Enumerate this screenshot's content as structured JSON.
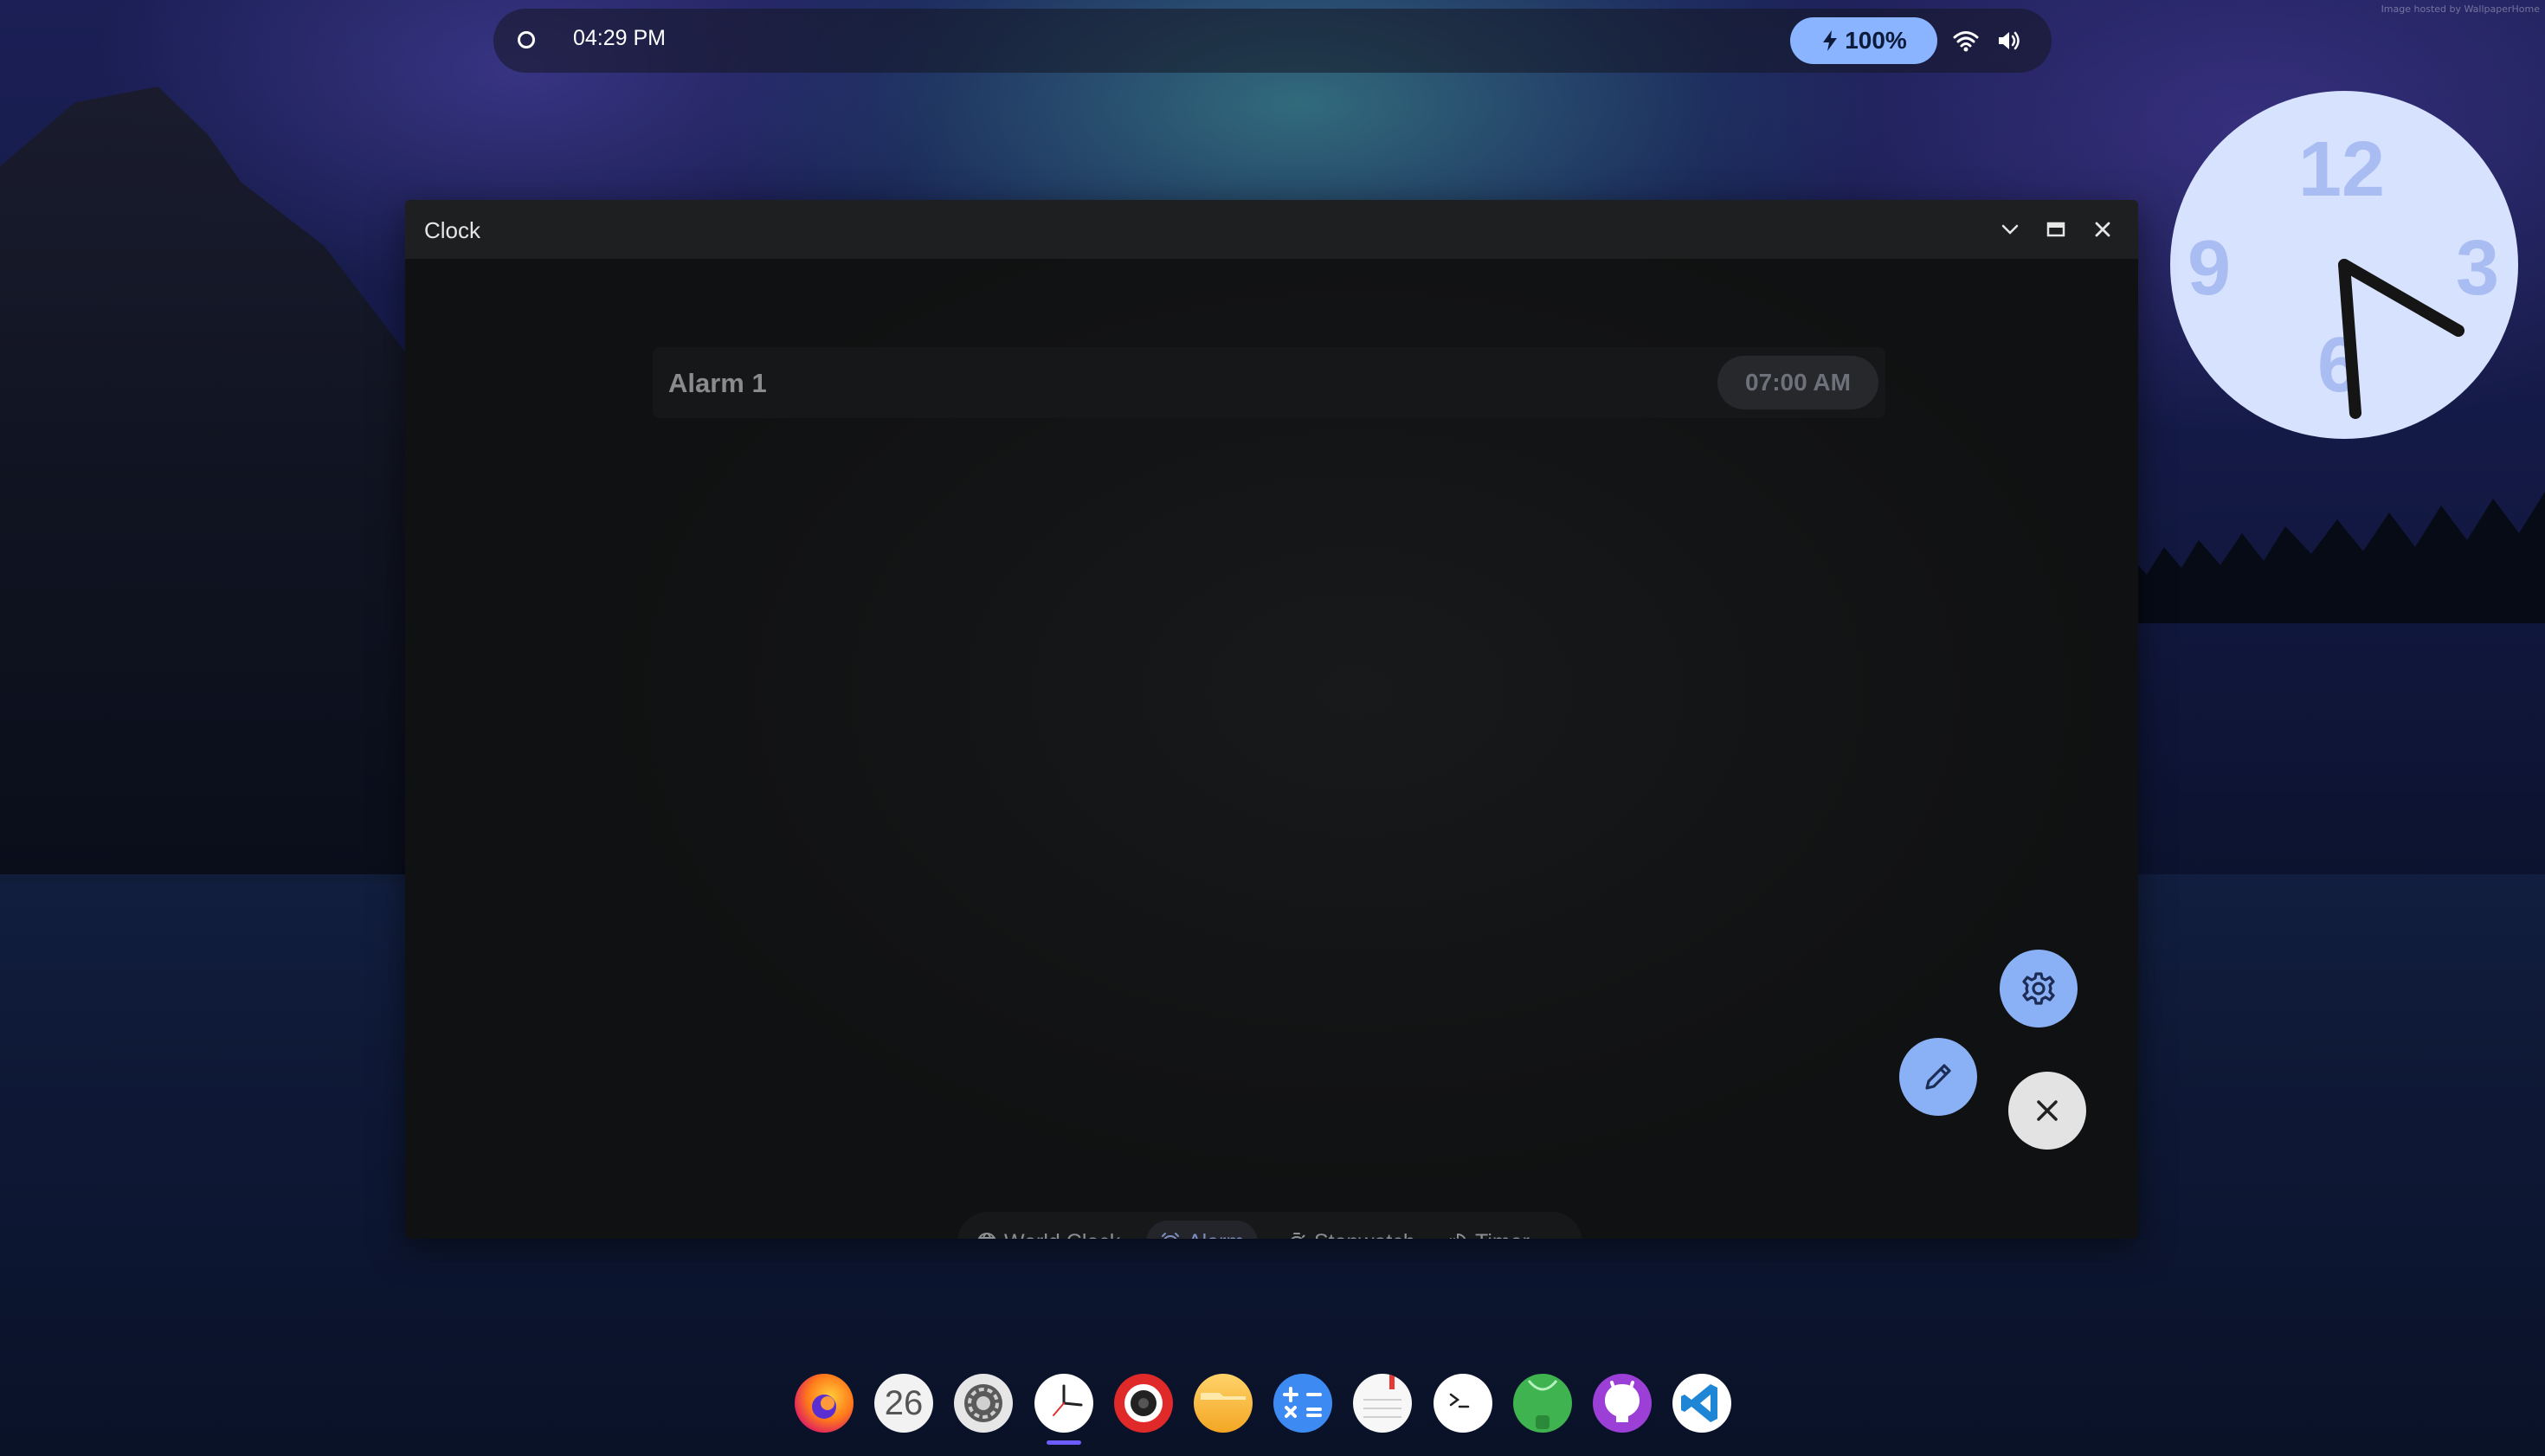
{
  "desktop": {
    "watermark": "Image hosted by WallpaperHome"
  },
  "topbar": {
    "time": "04:29 PM",
    "battery": "100%",
    "icons": [
      "circle-indicator",
      "bolt-icon",
      "wifi-icon",
      "volume-icon"
    ]
  },
  "analog_clock": {
    "numbers": [
      "12",
      "3",
      "6",
      "9"
    ],
    "hour_hand": "approximately 4:30",
    "colors": {
      "face": "#d7e2ff",
      "numbers": "#a9bdf2",
      "hands": "#151515"
    }
  },
  "window": {
    "title": "Clock",
    "controls": [
      "minimize",
      "maximize",
      "close"
    ]
  },
  "alarms": [
    {
      "name": "Alarm 1",
      "time": "07:00 AM"
    }
  ],
  "fabs": [
    "settings",
    "edit",
    "close"
  ],
  "nav": {
    "items": [
      {
        "label": "World Clock",
        "icon": "globe-icon"
      },
      {
        "label": "Alarm",
        "icon": "alarm-icon",
        "active": true
      },
      {
        "label": "Stopwatch",
        "icon": "stopwatch-icon"
      },
      {
        "label": "Timer",
        "icon": "timer-icon"
      }
    ]
  },
  "dock": {
    "apps": [
      "Firefox",
      "Calendar",
      "Settings",
      "Clock",
      "Screen Recorder",
      "Files",
      "Calculator",
      "Notes",
      "Terminal",
      "Android",
      "GitHub",
      "VS Code"
    ],
    "calendar_day": "26",
    "active": "Clock"
  },
  "colors": {
    "accent": "#8ab4ff",
    "window_bg": "#111213",
    "titlebar": "#1e1f21"
  }
}
